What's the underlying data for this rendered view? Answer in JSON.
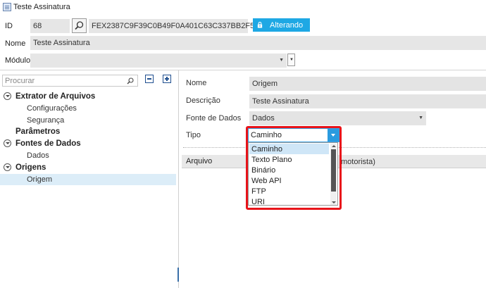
{
  "window": {
    "title": "Teste Assinatura"
  },
  "header": {
    "id_label": "ID",
    "id_value": "68",
    "hash_value": "FEX2387C9F39C0B49F0A401C63C337BB2F5032",
    "status_label": "Alterando",
    "nome_label": "Nome",
    "nome_value": "Teste Assinatura",
    "modulo_label": "Módulo",
    "modulo_value": ""
  },
  "sidebar": {
    "search_placeholder": "Procurar",
    "tree": [
      {
        "label": "Extrator de Arquivos",
        "level": 0,
        "expandable": true
      },
      {
        "label": "Configurações",
        "level": 1
      },
      {
        "label": "Segurança",
        "level": 1
      },
      {
        "label": "Parâmetros",
        "level": 0,
        "expandable": false
      },
      {
        "label": "Fontes de Dados",
        "level": 0,
        "expandable": true
      },
      {
        "label": "Dados",
        "level": 1
      },
      {
        "label": "Origens",
        "level": 0,
        "expandable": true
      },
      {
        "label": "Origem",
        "level": 1,
        "selected": true
      }
    ]
  },
  "form": {
    "nome_label": "Nome",
    "nome_value": "Origem",
    "descricao_label": "Descrição",
    "descricao_value": "Teste Assinatura",
    "fonte_label": "Fonte de Dados",
    "fonte_value": "Dados",
    "tipo_label": "Tipo",
    "tipo_value": "Caminho",
    "arquivo_label": "Arquivo",
    "arquivo_trailing": "motorista)"
  },
  "tipo_options": [
    "Caminho",
    "Texto Plano",
    "Binário",
    "Web API",
    "FTP",
    "URI"
  ],
  "colors": {
    "accent": "#1ea8e4",
    "highlight": "#e8141a",
    "selection": "#dcedf8"
  }
}
